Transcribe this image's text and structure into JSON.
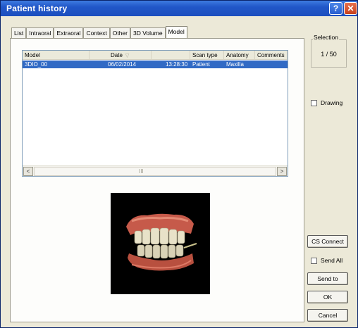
{
  "window": {
    "title": "Patient history",
    "help_glyph": "?",
    "close_glyph": "✕"
  },
  "tabs": [
    {
      "label": "List",
      "active": false
    },
    {
      "label": "Intraoral",
      "active": false
    },
    {
      "label": "Extraoral",
      "active": false
    },
    {
      "label": "Context",
      "active": false
    },
    {
      "label": "Other",
      "active": false
    },
    {
      "label": "3D Volume",
      "active": false
    },
    {
      "label": "Model",
      "active": true
    }
  ],
  "list": {
    "columns": [
      "Model",
      "Date",
      "",
      "Scan type",
      "Anatomy",
      "Comments"
    ],
    "rows": [
      {
        "model": "3DIO_00",
        "date": "06/02/2014",
        "time": "13:28:30",
        "scan_type": "Patient",
        "anatomy": "Maxilla",
        "comments": ""
      }
    ],
    "scroll_left": "<",
    "scroll_right": ">",
    "scroll_grip": "III"
  },
  "selection": {
    "label": "Selection",
    "value": "1 / 50"
  },
  "options": {
    "drawing_label": "Drawing",
    "drawing_checked": false,
    "send_all_label": "Send All",
    "send_all_checked": false
  },
  "buttons": {
    "cs_connect": "CS Connect",
    "send_to": "Send to",
    "ok": "OK",
    "cancel": "Cancel"
  },
  "colors": {
    "titlebar": "#2157c8",
    "selection_highlight": "#316ac5",
    "dialog_bg": "#ece9d8"
  }
}
